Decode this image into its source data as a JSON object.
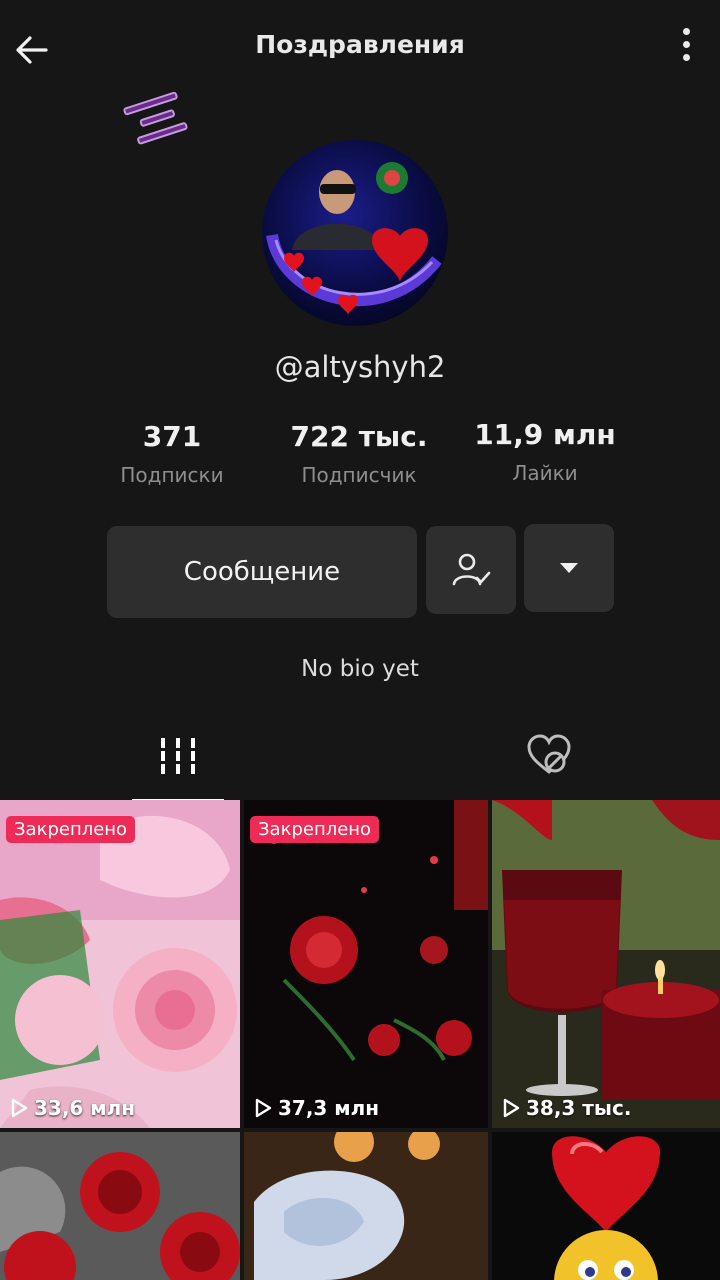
{
  "header": {
    "title": "Поздравления",
    "back_icon": "arrow-left-icon",
    "more_icon": "more-vertical-icon"
  },
  "profile": {
    "username": "@altyshyh2",
    "bio": "No bio yet"
  },
  "stats": [
    {
      "value": "371",
      "label": "Подписки"
    },
    {
      "value": "722 тыс.",
      "label": "Подписчик"
    },
    {
      "value": "11,9 млн",
      "label": "Лайки"
    }
  ],
  "actions": {
    "message_label": "Сообщение",
    "follow_icon": "user-check-icon",
    "dropdown_icon": "caret-down-icon"
  },
  "tabs": {
    "videos_icon": "grid-lines-icon",
    "liked_icon": "heart-hidden-icon"
  },
  "videos": [
    {
      "pinned_label": "Закреплено",
      "views": "33,6 млн"
    },
    {
      "pinned_label": "Закреплено",
      "views": "37,3 млн"
    },
    {
      "pinned_label": "",
      "views": "38,3 тыс."
    }
  ],
  "colors": {
    "background": "#161616",
    "button": "#2e2e2e",
    "pin_badge": "#ee2b56"
  }
}
